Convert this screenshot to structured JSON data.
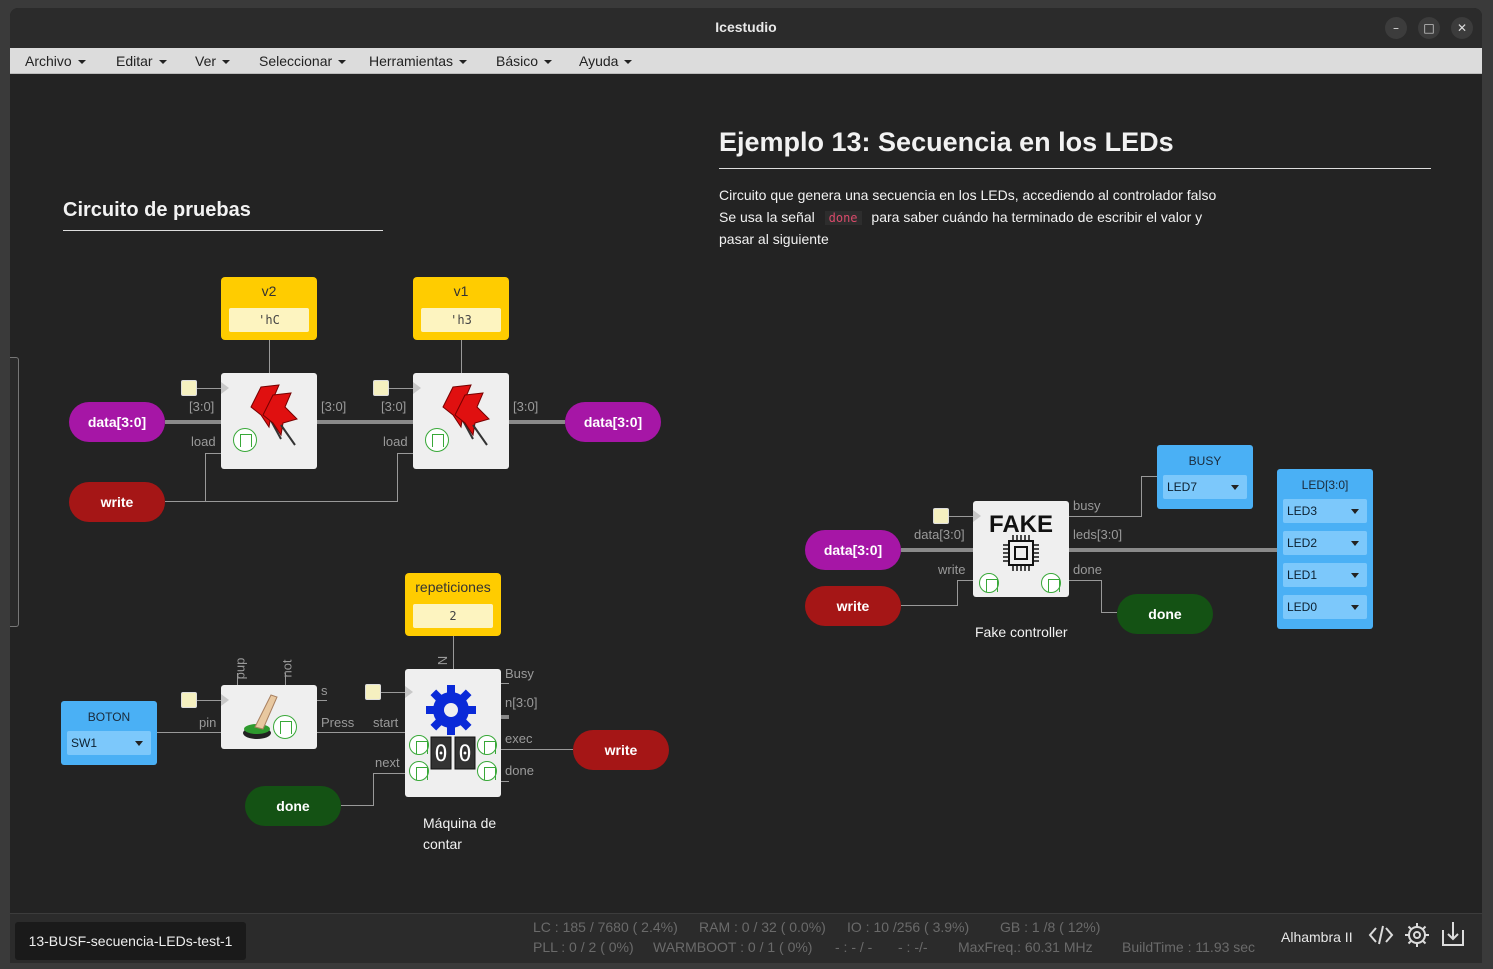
{
  "window": {
    "title": "Icestudio"
  },
  "window_controls": {
    "minimize": "–",
    "maximize": "□",
    "close": "✕"
  },
  "menu": [
    "Archivo",
    "Editar",
    "Ver",
    "Seleccionar",
    "Herramientas",
    "Básico",
    "Ayuda"
  ],
  "left": {
    "heading": "Circuito de pruebas",
    "const_v2": {
      "name": "v2",
      "value": "'hC"
    },
    "const_v1": {
      "name": "v1",
      "value": "'h3"
    },
    "const_rep": {
      "name": "repeticiones",
      "value": "2"
    },
    "bus_label": "[3:0]",
    "load_label": "load",
    "data_in": "data[3:0]",
    "data_out": "data[3:0]",
    "write_in": "write",
    "button": {
      "name": "BOTON",
      "pin": "SW1"
    },
    "btn_labels": {
      "pin": "pin",
      "pup": "pup",
      "not": "not",
      "s": "s",
      "press": "Press"
    },
    "counter_labels": {
      "n": "N",
      "start": "start",
      "next": "next",
      "busy": "Busy",
      "n_out": "n[3:0]",
      "exec": "exec",
      "done": "done"
    },
    "counter_caption_1": "Máquina de",
    "counter_caption_2": "contar",
    "write_out": "write",
    "done_in": "done"
  },
  "right": {
    "heading": "Ejemplo 13: Secuencia en los LEDs",
    "desc_line1": "Circuito que genera una secuencia en los LEDs, accediendo al controlador falso",
    "desc_line2_pre": "Se usa la señal",
    "desc_code": "done",
    "desc_line2_post": "para saber cuándo ha terminado de escribir el valor y",
    "desc_line3": "pasar al siguiente",
    "data_in": "data[3:0]",
    "write_in": "write",
    "fake_title": "FAKE",
    "fake_caption": "Fake controller",
    "fake_labels": {
      "data": "data[3:0]",
      "write": "write",
      "busy": "busy",
      "leds": "leds[3:0]",
      "done": "done"
    },
    "busy_pin": {
      "name": "BUSY",
      "pin": "LED7"
    },
    "led_pins": {
      "name": "LED[3:0]",
      "pins": [
        "LED3",
        "LED2",
        "LED1",
        "LED0"
      ]
    },
    "done_out": "done"
  },
  "status": {
    "project": "13-BUSF-secuencia-LEDs-test-1",
    "lc": "LC : 185 / 7680 ( 2.4%)",
    "ram": "RAM : 0 / 32 ( 0.0%)",
    "io": "IO : 10 /256 ( 3.9%)",
    "gb": "GB : 1 /8 ( 12%)",
    "pll": "PLL : 0 / 2 ( 0%)",
    "warmboot": "WARMBOOT : 0 / 1 ( 0%)",
    "dash1": "- : - / -",
    "dash2": "- : -/-",
    "maxfreq": "MaxFreq.: 60.31 MHz",
    "buildtime": "BuildTime : 11.93 sec",
    "board": "Alhambra II"
  }
}
